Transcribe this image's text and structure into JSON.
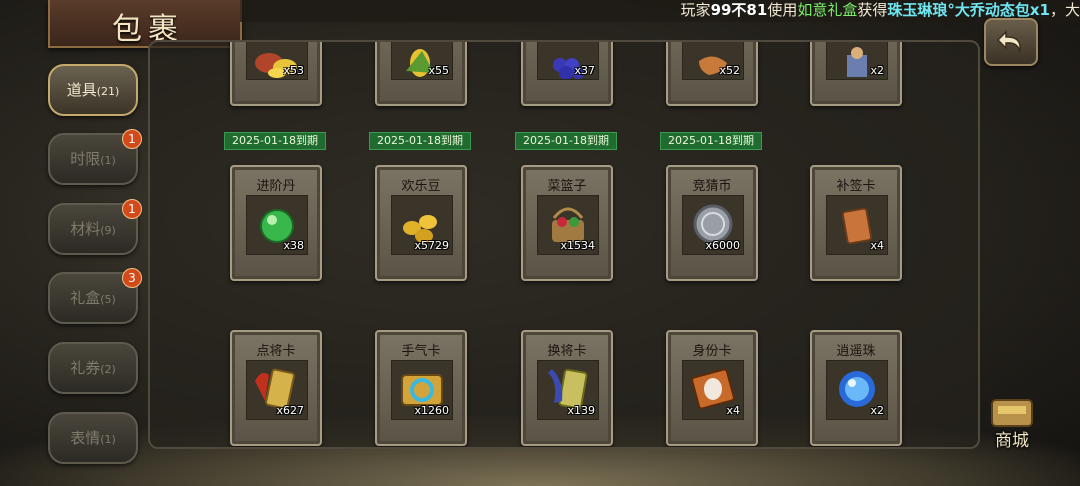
{
  "title": "包裹",
  "marquee": {
    "prefix": "玩家",
    "player_name": "99不81",
    "used": "使用",
    "item_used": "如意礼盒",
    "obtained": "获得",
    "reward": "珠玉琳琅°大乔动态包x1",
    "tail": "，大"
  },
  "tabs": [
    {
      "label": "道具",
      "count": "(21)",
      "active": true,
      "badge": ""
    },
    {
      "label": "时限",
      "count": "(1)",
      "active": false,
      "badge": "1"
    },
    {
      "label": "材料",
      "count": "(9)",
      "active": false,
      "badge": "1"
    },
    {
      "label": "礼盒",
      "count": "(5)",
      "active": false,
      "badge": "3"
    },
    {
      "label": "礼券",
      "count": "(2)",
      "active": false,
      "badge": ""
    },
    {
      "label": "表情",
      "count": "(1)",
      "active": false,
      "badge": ""
    }
  ],
  "row0": [
    {
      "count": "x53",
      "expiry": "2025-01-18到期",
      "icon": "food-icon"
    },
    {
      "count": "x55",
      "expiry": "2025-01-18到期",
      "icon": "corn-icon"
    },
    {
      "count": "x37",
      "expiry": "2025-01-18到期",
      "icon": "grape-icon"
    },
    {
      "count": "x52",
      "expiry": "2025-01-18到期",
      "icon": "cake-icon"
    },
    {
      "count": "x2",
      "expiry": "",
      "icon": "warrior-icon"
    }
  ],
  "row1": [
    {
      "name": "进阶丹",
      "count": "x38",
      "icon": "green-pill-icon"
    },
    {
      "name": "欢乐豆",
      "count": "x5729",
      "icon": "gold-beans-icon"
    },
    {
      "name": "菜篮子",
      "count": "x1534",
      "icon": "basket-icon"
    },
    {
      "name": "竞猜币",
      "count": "x6000",
      "icon": "silver-coin-icon"
    },
    {
      "name": "补签卡",
      "count": "x4",
      "icon": "sign-card-icon"
    }
  ],
  "row2": [
    {
      "name": "点将卡",
      "count": "x627",
      "icon": "general-card-icon"
    },
    {
      "name": "手气卡",
      "count": "x1260",
      "icon": "luck-card-icon"
    },
    {
      "name": "换将卡",
      "count": "x139",
      "icon": "swap-card-icon"
    },
    {
      "name": "身份卡",
      "count": "x4",
      "icon": "identity-card-icon"
    },
    {
      "name": "逍遥珠",
      "count": "x2",
      "icon": "blue-orb-icon"
    }
  ],
  "shop_label": "商城"
}
